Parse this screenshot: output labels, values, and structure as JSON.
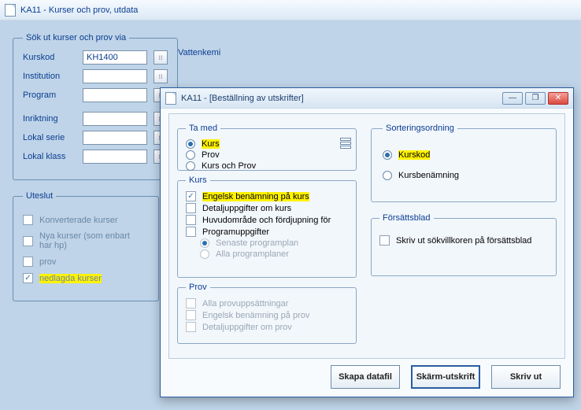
{
  "window": {
    "title": "KA11 - Kurser och prov, utdata"
  },
  "groups": {
    "search_legend": "Sök ut kurser och prov via",
    "exclude_legend": "Uteslut"
  },
  "search": {
    "kurskod_label": "Kurskod",
    "kurskod_value": "KH1400",
    "course_name": "Vattenkemi",
    "institution_label": "Institution",
    "program_label": "Program",
    "inriktning_label": "Inriktning",
    "lokal_serie_label": "Lokal serie",
    "lokal_klass_label": "Lokal klass"
  },
  "exclude": {
    "konverterade": "Konverterade kurser",
    "nya": "Nya kurser (som enbart har hp)",
    "prov": "prov",
    "nedlagda": "nedlagda kurser"
  },
  "dialog": {
    "title": "KA11 - [Beställning av utskrifter]",
    "tamed_legend": "Ta med",
    "kurs_legend": "Kurs",
    "prov_legend": "Prov",
    "sort_legend": "Sorteringsordning",
    "cover_legend": "Försättsblad",
    "tamed": {
      "kurs": "Kurs",
      "prov": "Prov",
      "kursochprov": "Kurs och Prov"
    },
    "kurs": {
      "engelsk": "Engelsk benämning på kurs",
      "detalj": "Detaljuppgifter om kurs",
      "huvud": "Huvudområde och fördjupning för",
      "programuppg": "Programuppgifter",
      "senaste": "Senaste programplan",
      "alla": "Alla programplaner"
    },
    "prov": {
      "alla_prov": "Alla provuppsättningar",
      "engelsk_prov": "Engelsk benämning på prov",
      "detalj_prov": "Detaljuppgifter om prov"
    },
    "sort": {
      "kurskod": "Kurskod",
      "kursben": "Kursbenämning"
    },
    "cover": {
      "skriv": "Skriv ut sökvillkoren på försättsblad"
    },
    "buttons": {
      "skapa": "Skapa datafil",
      "skarm": "Skärm-utskrift",
      "skriv": "Skriv ut"
    }
  }
}
